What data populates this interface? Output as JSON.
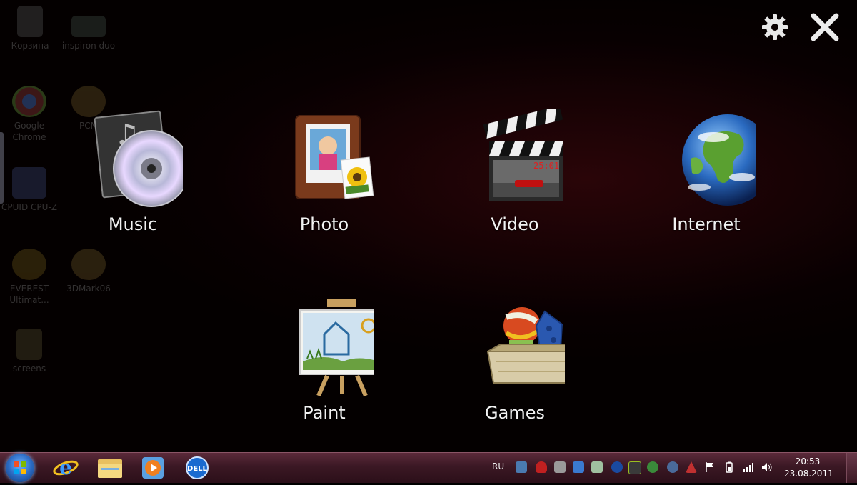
{
  "desktop_icons": [
    {
      "label": "Корзина",
      "icon": "recycle-bin-icon"
    },
    {
      "label": "inspiron duo",
      "icon": "shortcut-icon"
    },
    {
      "label": "Google Chrome",
      "icon": "chrome-icon"
    },
    {
      "label": "PCM",
      "icon": "pcmark-icon"
    },
    {
      "label": "CPUID CPU-Z",
      "icon": "cpuz-icon"
    },
    {
      "label": "EVEREST Ultimat...",
      "icon": "everest-icon"
    },
    {
      "label": "3DMark06",
      "icon": "3dmark-icon"
    },
    {
      "label": "screens",
      "icon": "folder-icon"
    }
  ],
  "overlay": {
    "settings_icon": "gear-icon",
    "close_icon": "close-icon",
    "apps": [
      {
        "label": "Music",
        "icon": "music-cd-icon"
      },
      {
        "label": "Photo",
        "icon": "photo-frame-icon"
      },
      {
        "label": "Video",
        "icon": "clapperboard-icon"
      },
      {
        "label": "Internet",
        "icon": "globe-icon"
      },
      {
        "label": "Paint",
        "icon": "easel-icon"
      },
      {
        "label": "Games",
        "icon": "toy-box-icon"
      }
    ]
  },
  "taskbar": {
    "pinned": [
      "internet-explorer-icon",
      "explorer-folder-icon",
      "media-player-icon",
      "dell-icon"
    ],
    "language": "RU",
    "time": "20:53",
    "date": "23.08.2011"
  },
  "colors": {
    "taskbar_top": "#5b2a3a",
    "taskbar_bottom": "#2b0f19",
    "desktop_glow": "#2a0508"
  }
}
